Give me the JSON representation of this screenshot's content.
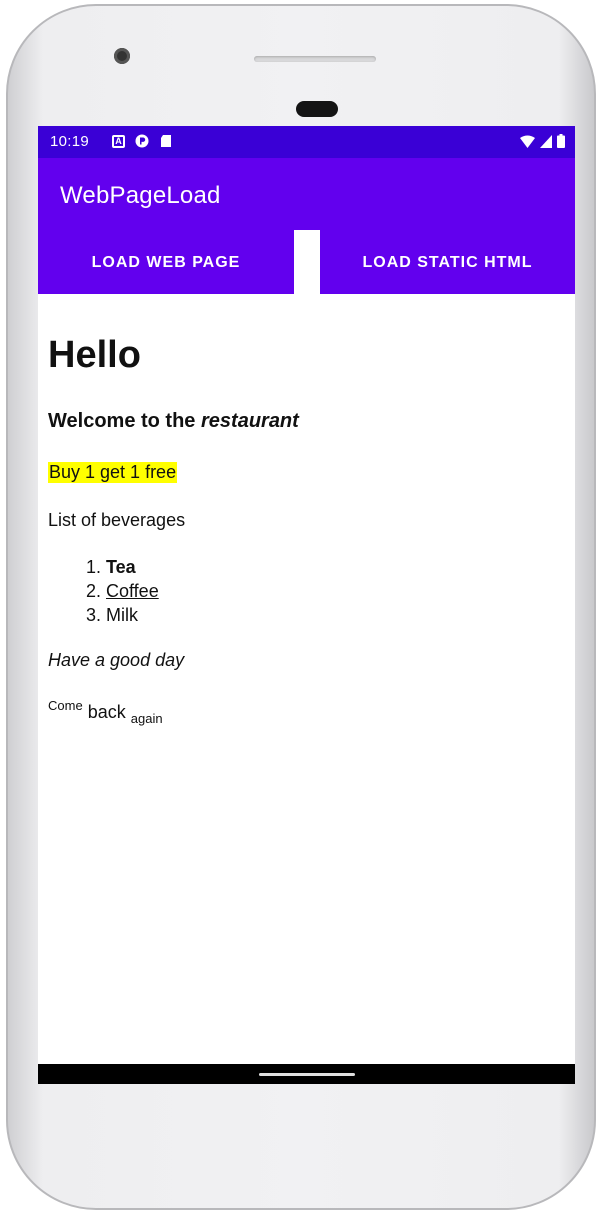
{
  "status_bar": {
    "time": "10:19",
    "left_icons": [
      "a-icon",
      "p-icon",
      "sd-card-icon"
    ],
    "right_icons": [
      "wifi-icon",
      "signal-icon",
      "battery-icon"
    ],
    "background": "#3a00d6"
  },
  "app_bar": {
    "title": "WebPageLoad",
    "background": "#6200ee"
  },
  "buttons": {
    "load_web_page": "LOAD WEB PAGE",
    "load_static_html": "LOAD STATIC HTML"
  },
  "webview": {
    "heading": "Hello",
    "welcome_prefix": "Welcome to the ",
    "welcome_emphasis": "restaurant",
    "promo": "Buy 1 get 1 free",
    "promo_highlight": "#ffff00",
    "list_title": "List of beverages",
    "beverages": [
      {
        "number": "1.",
        "name": "Tea"
      },
      {
        "number": "2.",
        "name": "Coffee"
      },
      {
        "number": "3.",
        "name": "Milk"
      }
    ],
    "farewell": "Have a good day",
    "come": "Come",
    "back": "back",
    "again": "again"
  }
}
